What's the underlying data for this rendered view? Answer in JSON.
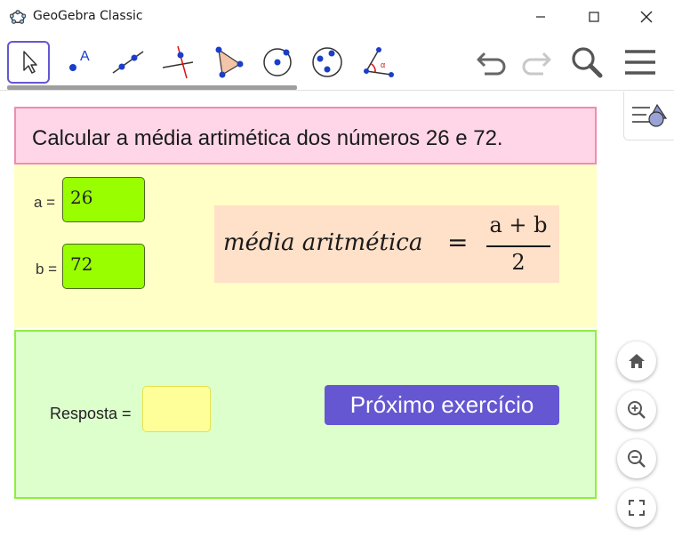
{
  "window": {
    "title": "GeoGebra Classic"
  },
  "toolbar": {
    "tools": [
      {
        "name": "move",
        "icon": "cursor-arrow-icon",
        "selected": true
      },
      {
        "name": "point",
        "icon": "point-icon"
      },
      {
        "name": "line",
        "icon": "line-through-two-points-icon"
      },
      {
        "name": "perpendicular-line",
        "icon": "perpendicular-line-icon"
      },
      {
        "name": "polygon",
        "icon": "polygon-icon"
      },
      {
        "name": "circle-center-point",
        "icon": "circle-with-center-icon"
      },
      {
        "name": "circle-three-points",
        "icon": "circle-through-points-icon"
      },
      {
        "name": "angle",
        "icon": "angle-icon"
      }
    ],
    "actions": [
      "undo-icon",
      "redo-icon",
      "search-icon",
      "menu-icon"
    ]
  },
  "header": {
    "text": "Calcular a média artimética dos números 26 e 72."
  },
  "inputs": {
    "a_label": "a =",
    "a_value": "26",
    "b_label": "b =",
    "b_value": "72"
  },
  "formula": {
    "lhs": "média aritmética",
    "eq": "=",
    "numerator": "a + b",
    "denominator": "2"
  },
  "answer": {
    "label": "Resposta =",
    "value": "",
    "next_button": "Próximo exercício"
  },
  "view_controls": [
    "home-icon",
    "zoom-in-icon",
    "zoom-out-icon",
    "fullscreen-icon"
  ],
  "colors": {
    "accent": "#6557d2",
    "header_bg": "#ffd6e7",
    "inputs_bg": "#ffffc6",
    "answer_bg": "#dcffcc",
    "input_box": "#99ff00",
    "answer_box": "#ffff99",
    "formula_bg": "#ffe0c8"
  }
}
